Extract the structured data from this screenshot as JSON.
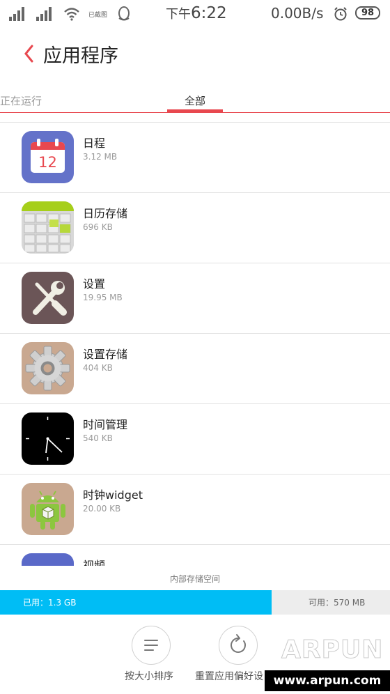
{
  "status_bar": {
    "carrier_text": "已截图",
    "time_prefix": "下午",
    "time": "6:22",
    "net_speed": "0.00B/s",
    "battery": "98"
  },
  "header": {
    "title": "应用程序"
  },
  "tabs": [
    {
      "label": "正在运行",
      "active": false
    },
    {
      "label": "全部",
      "active": true
    }
  ],
  "apps": [
    {
      "name": "日程",
      "size": "3.12 MB",
      "icon": "calendar-icon",
      "icon_text": "12"
    },
    {
      "name": "日历存储",
      "size": "696 KB",
      "icon": "calendar-storage-icon"
    },
    {
      "name": "设置",
      "size": "19.95 MB",
      "icon": "wrench-screwdriver-icon"
    },
    {
      "name": "设置存储",
      "size": "404 KB",
      "icon": "gear-icon"
    },
    {
      "name": "时间管理",
      "size": "540 KB",
      "icon": "clock-icon"
    },
    {
      "name": "时钟widget",
      "size": "20.00 KB",
      "icon": "android-icon"
    },
    {
      "name": "视频",
      "size": "",
      "icon": "video-icon"
    }
  ],
  "storage": {
    "label": "内部存储空间",
    "used": "已用：1.3 GB",
    "available": "可用：570 MB",
    "used_fraction": 0.696,
    "used_color": "#00bdf5"
  },
  "actions": [
    {
      "label": "按大小排序",
      "icon": "sort-list-icon"
    },
    {
      "label": "重置应用偏好设",
      "icon": "refresh-icon"
    }
  ],
  "watermark": {
    "text": "ARPUN",
    "url": "www.arpun.com"
  },
  "colors": {
    "accent": "#e8484f"
  }
}
